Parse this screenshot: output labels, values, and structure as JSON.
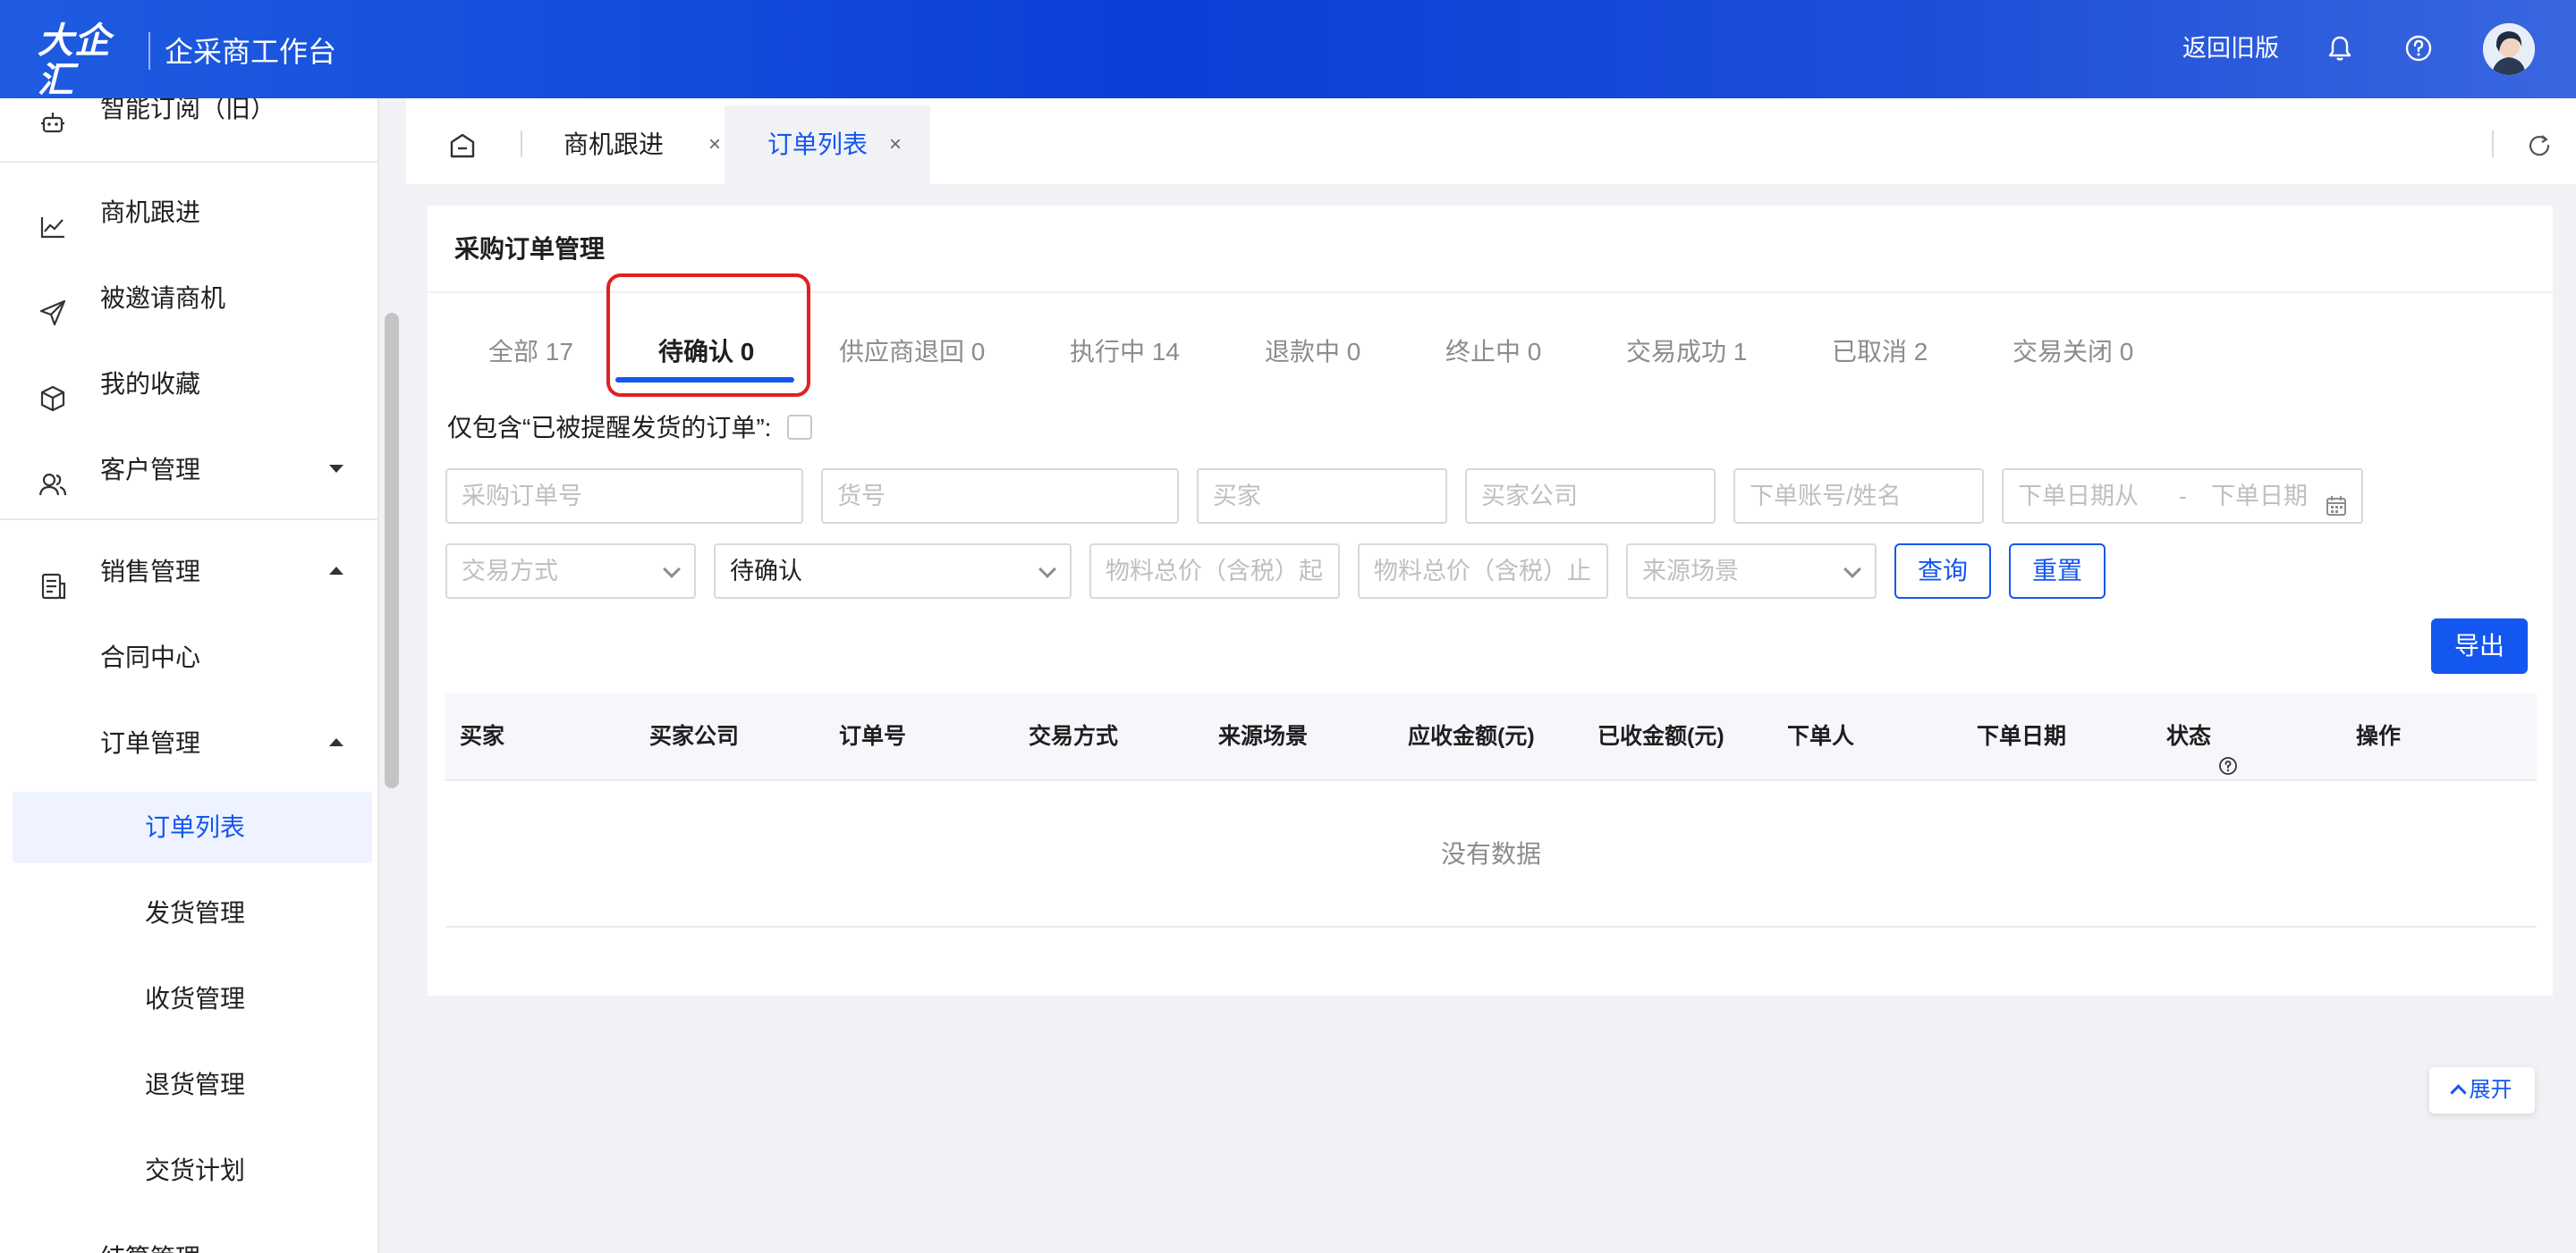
{
  "header": {
    "logo_text": "大企汇",
    "logo_domain": "daqihui.com",
    "app_title": "企采商工作台",
    "back_old": "返回旧版"
  },
  "sidebar": {
    "items": [
      {
        "label": "智能订阅（旧）",
        "icon": "robot-icon"
      },
      {
        "label": "商机跟进",
        "icon": "chart-icon"
      },
      {
        "label": "被邀请商机",
        "icon": "send-icon"
      },
      {
        "label": "我的收藏",
        "icon": "cube-icon"
      },
      {
        "label": "客户管理",
        "icon": "users-icon"
      },
      {
        "label": "销售管理",
        "icon": "document-icon"
      }
    ],
    "sub": {
      "contract": "合同中心",
      "order_mgmt": "订单管理",
      "order_list": "订单列表",
      "shipping": "发货管理",
      "receiving": "收货管理",
      "returns": "退货管理",
      "delivery_plan": "交货计划",
      "partial": "结算管理"
    }
  },
  "tabs": {
    "items": [
      {
        "label": "商机跟进"
      },
      {
        "label": "订单列表"
      }
    ],
    "close": "×"
  },
  "card": {
    "title": "采购订单管理",
    "status_tabs": [
      {
        "label": "全部 17"
      },
      {
        "label": "待确认 0"
      },
      {
        "label": "供应商退回 0"
      },
      {
        "label": "执行中 14"
      },
      {
        "label": "退款中 0"
      },
      {
        "label": "终止中 0"
      },
      {
        "label": "交易成功 1"
      },
      {
        "label": "已取消 2"
      },
      {
        "label": "交易关闭 0"
      }
    ],
    "remind_label": "仅包含“已被提醒发货的订单”:",
    "filters": {
      "purchase_order_no": "采购订单号",
      "item_no": "货号",
      "buyer": "买家",
      "buyer_company": "买家公司",
      "order_account": "下单账号/姓名",
      "date_from": "下单日期从",
      "date_sep": "-",
      "date_to": "下单日期",
      "trade_method": "交易方式",
      "status_value": "待确认",
      "total_from": "物料总价（含税）起",
      "total_to": "物料总价（含税）止",
      "source": "来源场景"
    },
    "buttons": {
      "query": "查询",
      "reset": "重置",
      "export": "导出"
    },
    "table": {
      "columns": [
        "买家",
        "买家公司",
        "订单号",
        "交易方式",
        "来源场景",
        "应收金额(元)",
        "已收金额(元)",
        "下单人",
        "下单日期",
        "状态",
        "操作"
      ],
      "empty": "没有数据"
    }
  },
  "expand_label": "展开",
  "colors": {
    "primary": "#1456f0",
    "header_gradient_start": "#1f5ce0",
    "highlight_box": "#e02020"
  }
}
